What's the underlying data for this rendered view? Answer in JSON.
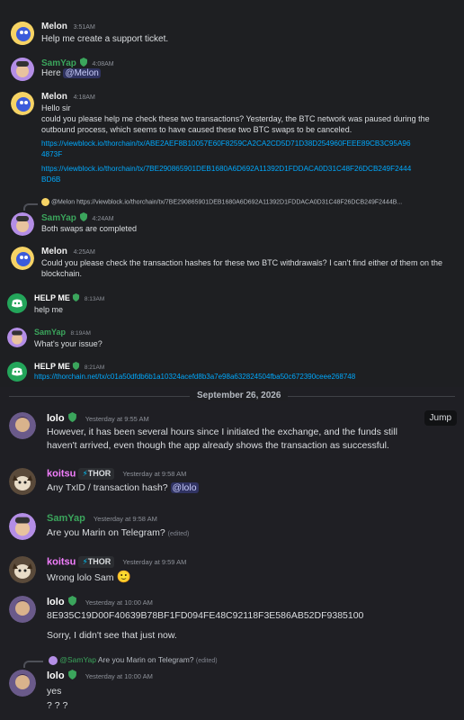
{
  "colors": {
    "melon_name": "#f0f0f0",
    "samyap_name": "#3ba55c",
    "helpme_name": "#ffffff",
    "koitsu_name": "#f47fff",
    "lolo_name": "#ffffff",
    "link": "#00a8fc",
    "discord_green": "#23a55a"
  },
  "panel1": {
    "messages": [
      {
        "user": "Melon",
        "time": "3:51AM",
        "lines": [
          "Help me create a support ticket."
        ]
      },
      {
        "user": "SamYap",
        "time": "4:08AM",
        "text_pre": "Here ",
        "mention": "@Melon"
      },
      {
        "user": "Melon",
        "time": "4:18AM",
        "lines": [
          "Hello sir",
          "could you please help me check these two transactions? Yesterday, the BTC network was paused during the",
          "outbound process, which seems to have caused these two BTC swaps to be canceled."
        ],
        "links": [
          [
            "https://viewblock.io/thorchain/tx/ABE2AEF8B10057E60F8259CA2CA2CD5D71D38D254960FEEE89CB3C95A96",
            "4873F"
          ],
          [
            "https://viewblock.io/thorchain/tx/7BE290865901DEB1680A6D692A11392D1FDDACA0D31C48F26DCB249F2444",
            "BD6B"
          ]
        ]
      },
      {
        "user": "SamYap",
        "time": "4:24AM",
        "reply": "@Melon https://viewblock.io/thorchain/tx/7BE290865901DEB1680A6D692A11392D1FDDACA0D31C48F26DCB249F2444B...",
        "lines": [
          "Both swaps are completed"
        ]
      },
      {
        "user": "Melon",
        "time": "4:25AM",
        "lines": [
          "Could you please check the transaction hashes for these two BTC withdrawals? I can't find either of them on the",
          "blockchain."
        ]
      }
    ]
  },
  "panel2": {
    "messages": [
      {
        "user": "HELP ME",
        "time": "8:13AM",
        "text": "help me"
      },
      {
        "user": "SamYap",
        "time": "8:19AM",
        "text": "What's your issue?"
      },
      {
        "user": "HELP ME",
        "time": "8:21AM",
        "link": "https://thorchain.net/tx/c01a50dfdb6b1a10324acefd8b3a7e98a632824504fba50c672390ceee268748"
      }
    ]
  },
  "panel3": {
    "date_divider": "September 26, 2026",
    "jump_label": "Jump",
    "messages": [
      {
        "user": "lolo",
        "time": "Yesterday at 9:55 AM",
        "lines": [
          "However, it has been several hours since I initiated the exchange, and the funds still",
          "haven't arrived, even though the app already shows the transaction as successful."
        ]
      },
      {
        "user": "koitsu",
        "badge": "THOR",
        "time": "Yesterday at 9:58 AM",
        "text_pre": "Any TxID / transaction hash? ",
        "mention": "@lolo"
      },
      {
        "user": "SamYap",
        "time": "Yesterday at 9:58 AM",
        "text": "Are you Marin on Telegram?",
        "edited": "(edited)"
      },
      {
        "user": "koitsu",
        "badge": "THOR",
        "time": "Yesterday at 9:59 AM",
        "text": "Wrong lolo Sam",
        "emoji": "🙂"
      },
      {
        "user": "lolo",
        "time": "Yesterday at 10:00 AM",
        "hash": "8E935C19D00F40639B78BF1FD094FE48C92118F3E586AB52DF9385100",
        "text2": "Sorry, I didn't see that just now."
      },
      {
        "user": "lolo",
        "time": "Yesterday at 10:00 AM",
        "reply_user": "@SamYap",
        "reply_text": "Are you Marin on Telegram?",
        "reply_edited": "(edited)",
        "lines": [
          "yes",
          "? ? ?"
        ]
      }
    ]
  }
}
